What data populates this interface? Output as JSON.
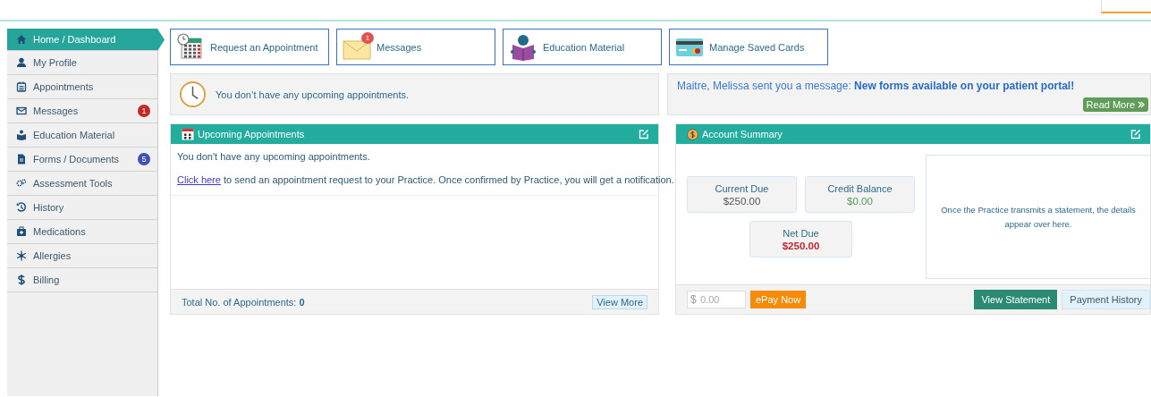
{
  "sidebar": {
    "items": [
      {
        "label": "Home / Dashboard",
        "selected": true
      },
      {
        "label": "My Profile",
        "selected": false
      },
      {
        "label": "Appointments",
        "selected": false
      },
      {
        "label": "Messages",
        "selected": false,
        "badge": "1",
        "color": "#c62828"
      },
      {
        "label": "Education Material",
        "selected": false
      },
      {
        "label": "Forms / Documents",
        "selected": false,
        "badge": "5",
        "color": "#3f51b5"
      },
      {
        "label": "Assessment Tools",
        "selected": false
      },
      {
        "label": "History",
        "selected": false
      },
      {
        "label": "Medications",
        "selected": false
      },
      {
        "label": "Allergies",
        "selected": false
      },
      {
        "label": "Billing",
        "selected": false
      }
    ]
  },
  "shortcuts": [
    {
      "label": "Request an Appointment"
    },
    {
      "label": "Messages",
      "badge": "1"
    },
    {
      "label": "Education Material"
    },
    {
      "label": "Manage Saved Cards"
    }
  ],
  "notice": {
    "text": "You don’t have any upcoming appointments."
  },
  "message": {
    "text": "Maitre, Melissa sent you a message: **New forms available on your patient portal!**",
    "button": "Read More"
  },
  "appointments_panel": {
    "title": "Upcoming Appointments",
    "empty_text": "You don't have any upcoming appointments.",
    "link": "Click here",
    "link_rest": "to send an appointment request to your Practice. Once confirmed by Practice, you will get a notification.",
    "total_label": "Total No. of Appointments:",
    "total": "0",
    "button": "View More"
  },
  "account_panel": {
    "title": "Account Summary",
    "tiles": [
      {
        "label": "Current Due",
        "value": "$250.00",
        "color": "#555555"
      },
      {
        "label": "Credit Balance",
        "value": "$0.00",
        "color": "#4e9a5a"
      },
      {
        "label": "Net Due",
        "value": "$250.00",
        "color": "#c0282d"
      }
    ],
    "statement_note": "Once the Practice transmits a statement, the details appear over here.",
    "amount": {
      "prefix": "$",
      "placeholder": "0.00"
    },
    "pay_button": "ePay Now",
    "buttons": [
      "View Statement",
      "Payment History"
    ]
  }
}
